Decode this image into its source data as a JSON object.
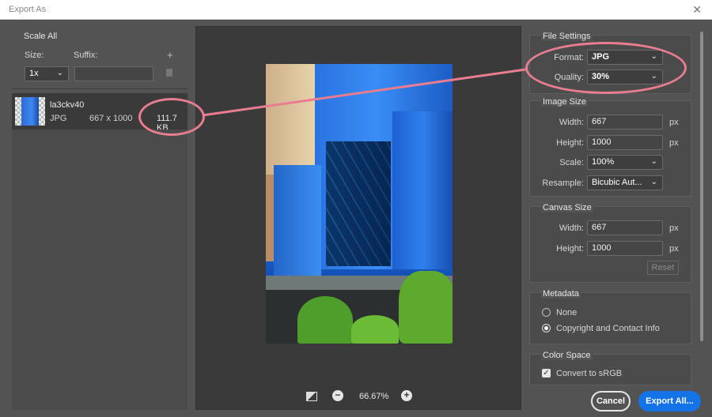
{
  "window": {
    "title": "Export As"
  },
  "left": {
    "section_title": "Scale All",
    "size_label": "Size:",
    "suffix_label": "Suffix:",
    "size_value": "1x",
    "suffix_value": "",
    "add_glyph": "+"
  },
  "asset": {
    "name": "la3ckv40",
    "format": "JPG",
    "dimensions": "667 x 1000",
    "filesize": "111.7 KB"
  },
  "preview": {
    "zoom": "66.67%"
  },
  "file_settings": {
    "title": "File Settings",
    "format_label": "Format:",
    "format_value": "JPG",
    "quality_label": "Quality:",
    "quality_value": "30%"
  },
  "image_size": {
    "title": "Image Size",
    "width_label": "Width:",
    "width_value": "667",
    "height_label": "Height:",
    "height_value": "1000",
    "scale_label": "Scale:",
    "scale_value": "100%",
    "resample_label": "Resample:",
    "resample_value": "Bicubic Aut...",
    "unit": "px"
  },
  "canvas_size": {
    "title": "Canvas Size",
    "width_label": "Width:",
    "width_value": "667",
    "height_label": "Height:",
    "height_value": "1000",
    "reset_label": "Reset",
    "unit": "px"
  },
  "metadata": {
    "title": "Metadata",
    "options": [
      "None",
      "Copyright and Contact Info"
    ],
    "selected_index": 1
  },
  "color_space": {
    "title": "Color Space",
    "convert_label": "Convert to sRGB",
    "checked": true
  },
  "footer": {
    "cancel_label": "Cancel",
    "export_label": "Export All..."
  },
  "colors": {
    "accent": "#1473e6",
    "annotation": "#e87d91",
    "panel": "#4b4b4b"
  }
}
